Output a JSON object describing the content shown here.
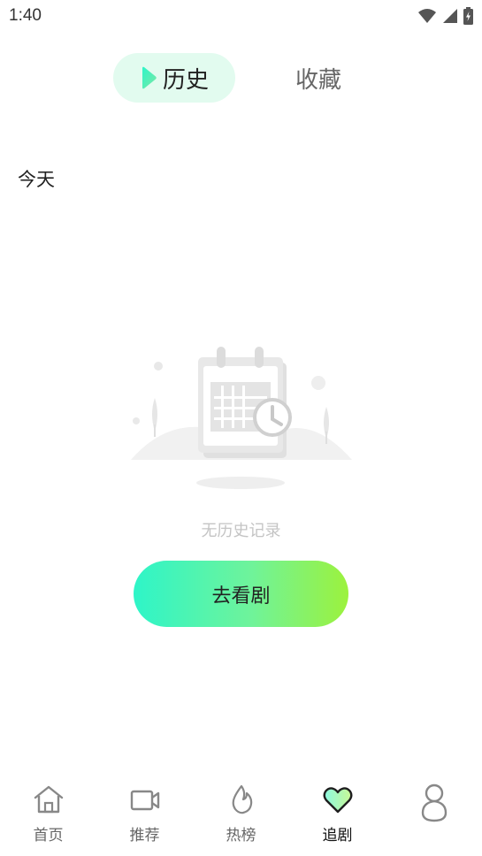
{
  "status_bar": {
    "time": "1:40"
  },
  "tabs": [
    {
      "label": "历史",
      "active": true
    },
    {
      "label": "收藏",
      "active": false
    }
  ],
  "section": {
    "today_label": "今天"
  },
  "empty_state": {
    "message": "无历史记录",
    "button_label": "去看剧"
  },
  "bottom_nav": [
    {
      "label": "首页",
      "icon": "home-icon",
      "active": false
    },
    {
      "label": "推荐",
      "icon": "video-camera-icon",
      "active": false
    },
    {
      "label": "热榜",
      "icon": "flame-icon",
      "active": false
    },
    {
      "label": "追剧",
      "icon": "heart-icon",
      "active": true
    },
    {
      "label": "",
      "icon": "profile-icon",
      "active": false
    }
  ],
  "colors": {
    "accent_green": "#2ef5c8",
    "accent_lime": "#9cf23d",
    "tab_bg": "#e2fbef"
  }
}
